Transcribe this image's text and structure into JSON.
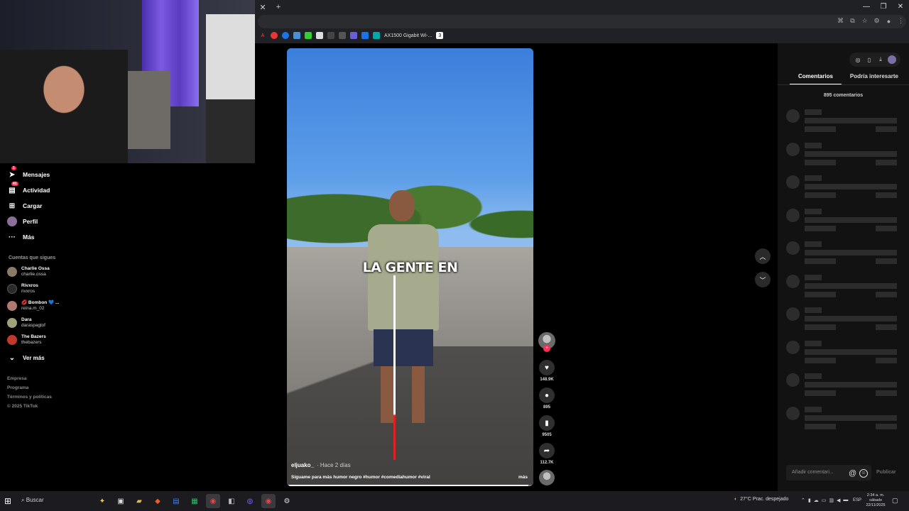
{
  "browser": {
    "bookmarks": [
      "AX1500 Gigabit Wi-..."
    ],
    "window_controls": [
      "—",
      "❐",
      "✕"
    ]
  },
  "sidebar": {
    "nav": [
      {
        "label": "Mensajes",
        "icon": "send-icon",
        "badge": "1"
      },
      {
        "label": "Actividad",
        "icon": "inbox-icon",
        "badge": "41"
      },
      {
        "label": "Cargar",
        "icon": "upload-icon",
        "badge": ""
      },
      {
        "label": "Perfil",
        "icon": "avatar-icon",
        "badge": ""
      },
      {
        "label": "Más",
        "icon": "more-icon",
        "badge": ""
      }
    ],
    "following_title": "Cuentas que sigues",
    "accounts": [
      {
        "name": "Charlie Ossa",
        "handle": "charlie.ossa",
        "color": "#8b7a68"
      },
      {
        "name": "Rivxros",
        "handle": "rivxros",
        "color": "#2a2a2a"
      },
      {
        "name": "💋 Bombon 💙 ...",
        "handle": "reina.m_02",
        "color": "#b07a70"
      },
      {
        "name": "Dara",
        "handle": "daraspaglof",
        "color": "#a0a07a"
      },
      {
        "name": "The Bazers",
        "handle": "thebazers",
        "color": "#c0392b"
      }
    ],
    "see_more": "Ver más",
    "footer": [
      "Empresa",
      "Programa",
      "Términos y políticas",
      "© 2025 TikTok"
    ]
  },
  "video": {
    "caption": "LA GENTE EN",
    "author": "eljuako_",
    "time": "· Hace 2 días",
    "description": "Síguame para más humor negro #humor #comediahumor #viral",
    "more": "más",
    "progress": 0.98
  },
  "actions": {
    "likes": "148.9K",
    "comments": "895",
    "saves": "9505",
    "shares": "112.7K"
  },
  "comments_panel": {
    "tabs": [
      "Comentarios",
      "Podría interesarte"
    ],
    "count": "895 comentarios",
    "input_placeholder": "Añadir comentari...",
    "at_symbol": "@",
    "emoji": "☺",
    "publish": "Publicar"
  },
  "taskbar": {
    "search": "Buscar",
    "weather": "27°C  Prac. despejado",
    "lang": "ESP",
    "time": "2:34 a. m.",
    "day": "sábado",
    "date": "22/11/2025"
  }
}
